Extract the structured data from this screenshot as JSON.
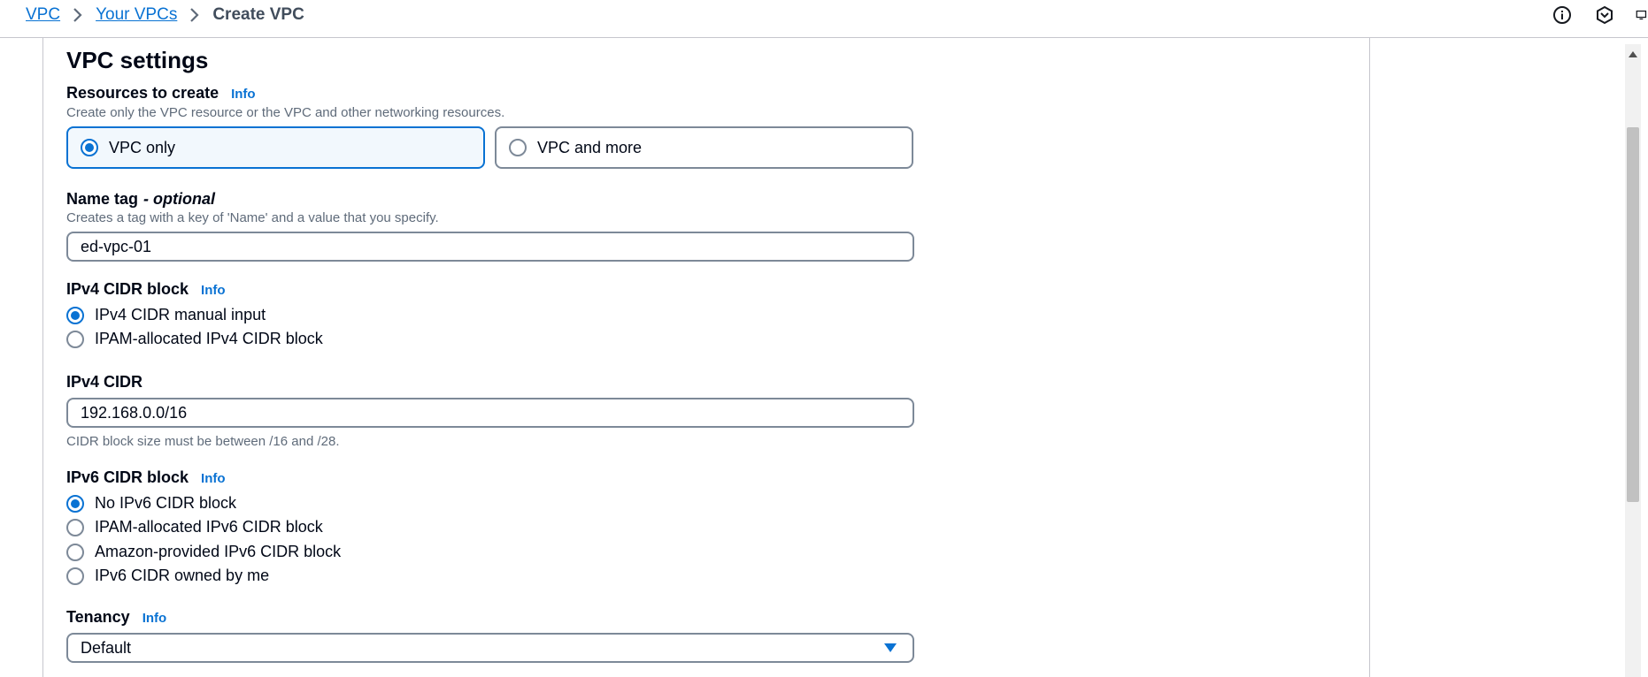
{
  "breadcrumb": {
    "items": [
      {
        "label": "VPC"
      },
      {
        "label": "Your VPCs"
      }
    ],
    "current": "Create VPC"
  },
  "header_icons": [
    "info-circle-icon",
    "settings-hexagon-icon",
    "display-icon"
  ],
  "panel": {
    "title": "VPC settings"
  },
  "resources": {
    "label": "Resources to create",
    "info": "Info",
    "description": "Create only the VPC resource or the VPC and other networking resources.",
    "options": [
      {
        "label": "VPC only",
        "selected": true
      },
      {
        "label": "VPC and more",
        "selected": false
      }
    ]
  },
  "name_tag": {
    "label": "Name tag",
    "optional": "- optional",
    "description": "Creates a tag with a key of 'Name' and a value that you specify.",
    "value": "ed-vpc-01"
  },
  "ipv4_block": {
    "label": "IPv4 CIDR block",
    "info": "Info",
    "options": [
      {
        "label": "IPv4 CIDR manual input",
        "selected": true
      },
      {
        "label": "IPAM-allocated IPv4 CIDR block",
        "selected": false
      }
    ]
  },
  "ipv4_cidr": {
    "label": "IPv4 CIDR",
    "value": "192.168.0.0/16",
    "hint": "CIDR block size must be between /16 and /28."
  },
  "ipv6_block": {
    "label": "IPv6 CIDR block",
    "info": "Info",
    "options": [
      {
        "label": "No IPv6 CIDR block",
        "selected": true
      },
      {
        "label": "IPAM-allocated IPv6 CIDR block",
        "selected": false
      },
      {
        "label": "Amazon-provided IPv6 CIDR block",
        "selected": false
      },
      {
        "label": "IPv6 CIDR owned by me",
        "selected": false
      }
    ]
  },
  "tenancy": {
    "label": "Tenancy",
    "info": "Info",
    "value": "Default"
  },
  "colors": {
    "link": "#0972d3",
    "selected_tile_bg": "#f2f8fd",
    "border": "#7d8998",
    "text_secondary": "#5f6b7a"
  }
}
